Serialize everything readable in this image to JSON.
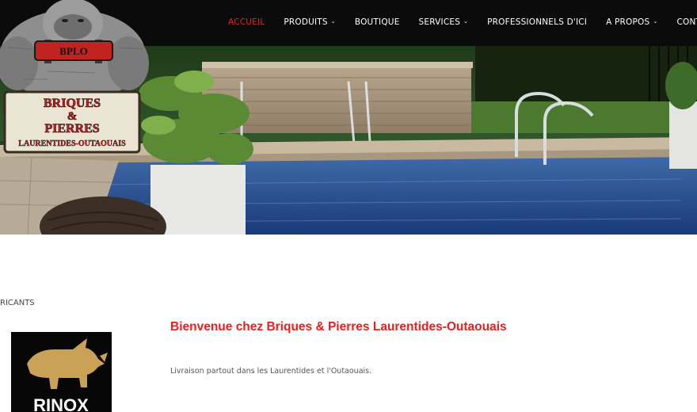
{
  "colors": {
    "nav_bg": "#0b0b0b",
    "active": "#d42a22",
    "brand_red": "#ee1c1c",
    "rinox_gold": "#c9a257"
  },
  "nav": {
    "items": [
      {
        "label": "ACCUEIL",
        "active": true,
        "dropdown": false
      },
      {
        "label": "PRODUITS",
        "active": false,
        "dropdown": true
      },
      {
        "label": "BOUTIQUE",
        "active": false,
        "dropdown": false
      },
      {
        "label": "SERVICES",
        "active": false,
        "dropdown": true
      },
      {
        "label": "PROFESSIONNELS D'ICI",
        "active": false,
        "dropdown": false
      },
      {
        "label": "A PROPOS",
        "active": false,
        "dropdown": true
      },
      {
        "label": "CONTACT",
        "active": false,
        "dropdown": false
      }
    ],
    "caret": "⌄"
  },
  "logo": {
    "badge": "BPLO",
    "line1": "BRIQUES",
    "line2": "&",
    "line3": "PIERRES",
    "line4": "LAURENTIDES-OUTAOUAIS"
  },
  "sidebar": {
    "label": "RICANTS",
    "brand": "RINOX"
  },
  "main": {
    "welcome": "Bienvenue chez Briques & Pierres Laurentides-Outaouais",
    "delivery": "Livraison partout dans les Laurentides et l'Outaouais."
  }
}
